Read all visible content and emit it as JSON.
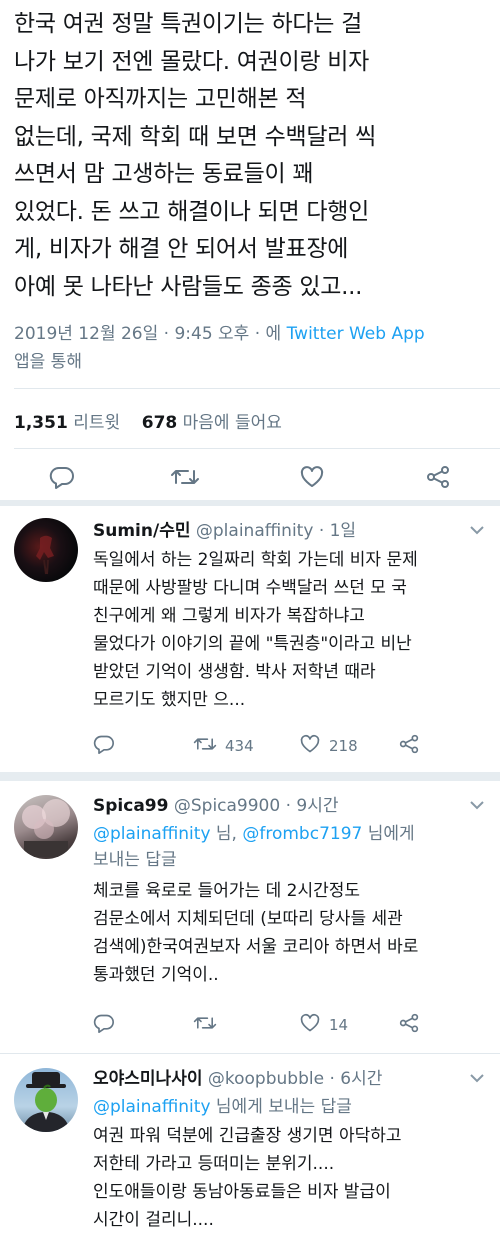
{
  "main_tweet": {
    "lines": [
      "한국 여권 정말 특권이기는 하다는 걸",
      "나가 보기 전엔 몰랐다. 여권이랑 비자",
      "문제로 아직까지는 고민해본 적",
      "없는데, 국제 학회 때 보면 수백달러 씩",
      "쓰면서 맘 고생하는 동료들이 꽤",
      "있었다. 돈 쓰고 해결이나 되면 다행인",
      "게, 비자가 해결 안 되어서 발표장에",
      "아예 못 나타난 사람들도 종종 있고..."
    ],
    "timestamp": "2019년 12월 26일 · 9:45 오후 · 에",
    "source": "Twitter Web App",
    "via": "앱을 통해",
    "retweet_count": "1,351",
    "retweet_label": "리트윗",
    "like_count": "678",
    "like_label": "마음에 들어요"
  },
  "replies": [
    {
      "name": "Sumin/수민",
      "handle": "@plainaffinity",
      "time": "· 1일",
      "lines": [
        "독일에서 하는 2일짜리 학회 가는데 비자 문제",
        "때문에 사방팔방 다니며 수백달러 쓰던 모 국",
        "친구에게 왜 그렇게 비자가 복잡하냐고",
        "물었다가 이야기의 끝에 \"특권층\"이라고 비난",
        "받았던 기억이 생생함. 박사 저학년 때라",
        "모르기도 했지만 으..."
      ],
      "retweets": "434",
      "likes": "218"
    },
    {
      "name": "Spica99",
      "handle": "@Spica9900",
      "time": "· 9시간",
      "reply_to_1": "@plainaffinity",
      "reply_to_mid": "님,",
      "reply_to_2": "@frombc7197",
      "reply_to_end": "님에게",
      "reply_to_line2": "보내는 답글",
      "lines": [
        "체코를 육로로 들어가는 데 2시간정도",
        "검문소에서 지체되던데 (보따리 당사들 세관",
        "검색에)한국여권보자 서울 코리아 하면서 바로",
        "통과했던 기억이.."
      ],
      "likes": "14"
    },
    {
      "name": "오야스미나사이",
      "handle": "@koopbubble",
      "time": "· 6시간",
      "reply_to_1": "@plainaffinity",
      "reply_to_end": "님에게 보내는 답글",
      "lines": [
        "여권 파워 덕분에 긴급출장 생기면 아닥하고",
        "저한테 가라고 등떠미는 분위기....",
        "인도애들이랑 동남아동료들은 비자 발급이",
        "시간이 걸리니...."
      ]
    }
  ],
  "colors": {
    "link": "#1da1f2",
    "muted": "#657786",
    "text": "#14171a",
    "separator": "#e6ecf0"
  }
}
